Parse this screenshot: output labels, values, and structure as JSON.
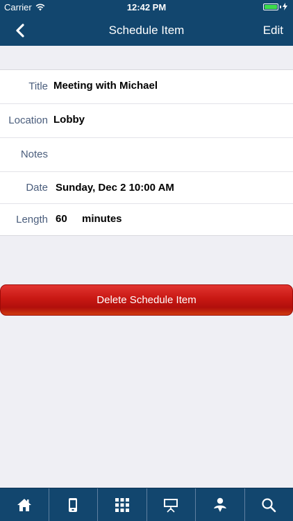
{
  "status_bar": {
    "carrier": "Carrier",
    "time": "12:42 PM"
  },
  "nav": {
    "back_icon": "chevron-left-icon",
    "title": "Schedule Item",
    "edit_label": "Edit"
  },
  "fields": [
    {
      "label": "Title",
      "value": "Meeting with Michael"
    },
    {
      "label": "Location",
      "value": "Lobby"
    },
    {
      "label": "Notes",
      "value": ""
    },
    {
      "label": "Date",
      "value": "Sunday, Dec 2 10:00 AM"
    },
    {
      "label": "Length",
      "value": "60",
      "unit": "minutes"
    }
  ],
  "delete_label": "Delete Schedule Item",
  "tabs": [
    "home-icon",
    "phone-icon",
    "grid-icon",
    "presentation-icon",
    "person-icon",
    "search-icon"
  ],
  "colors": {
    "bar": "#12466e",
    "label": "#4a5d7c",
    "delete": "#c81813",
    "background": "#efeff4"
  }
}
